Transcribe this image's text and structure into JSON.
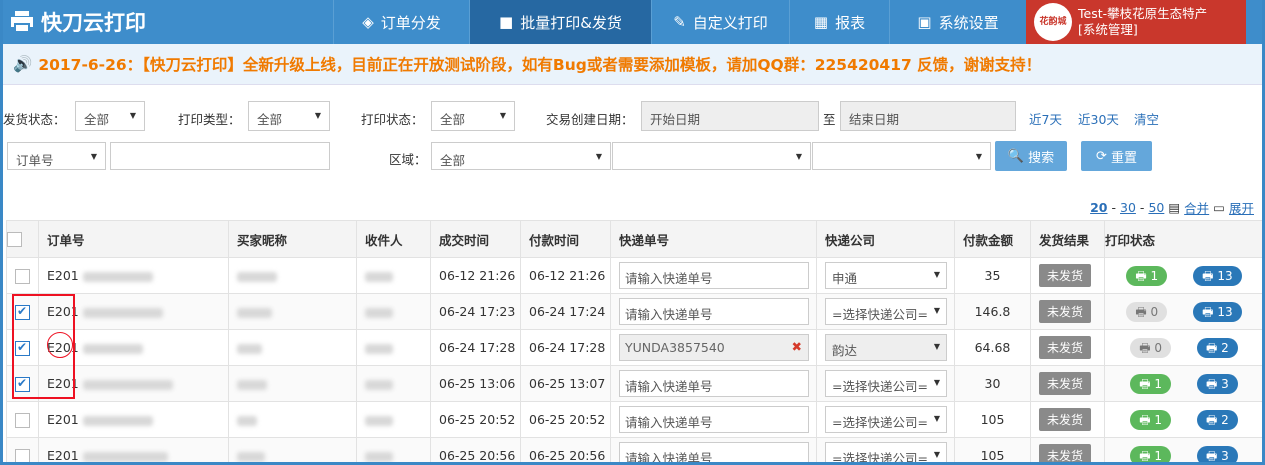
{
  "header": {
    "logo_text": "快刀云打印",
    "nav": [
      {
        "label": "订单分发",
        "icon": "share-icon"
      },
      {
        "label": "批量打印&发货",
        "icon": "ship-icon"
      },
      {
        "label": "自定义打印",
        "icon": "pencil-icon"
      },
      {
        "label": "报表",
        "icon": "calendar-icon"
      },
      {
        "label": "系统设置",
        "icon": "grid-icon"
      }
    ],
    "avatar_text": "花韵城",
    "user_line1": "Test-攀枝花原生态特产",
    "user_line2": "[系统管理]"
  },
  "notice": "2017-6-26：【快刀云打印】全新升级上线，目前正在开放测试阶段，如有Bug或者需要添加模板，请加QQ群：225420417 反馈，谢谢支持！",
  "filters": {
    "ship_status_label": "发货状态：",
    "ship_status_value": "全部",
    "print_type_label": "打印类型：",
    "print_type_value": "全部",
    "print_status_label": "打印状态：",
    "print_status_value": "全部",
    "date_label": "交易创建日期：",
    "date_start": "开始日期",
    "date_to": "至",
    "date_end": "结束日期",
    "last7": "近7天",
    "last30": "近30天",
    "clear": "清空",
    "order_field": "订单号",
    "region_label": "区域：",
    "region_value": "全部",
    "search": "搜索",
    "reset": "重置"
  },
  "pager": {
    "sizes": [
      "20",
      "30",
      "50"
    ],
    "sep": "-",
    "merge": "合并",
    "expand": "展开"
  },
  "table": {
    "headers": [
      "订单号",
      "买家昵称",
      "收件人",
      "成交时间",
      "付款时间",
      "快递单号",
      "快递公司",
      "付款金额",
      "发货结果",
      "打印状态"
    ],
    "rows": [
      {
        "checked": false,
        "order": "E201",
        "deal": "06-12 21:26",
        "pay": "06-12 21:26",
        "track": "请输入快递单号",
        "track_filled": false,
        "courier": "申通",
        "amount": "35",
        "result": "未发货",
        "p1": "1",
        "p1_on": true,
        "p2": "13"
      },
      {
        "checked": true,
        "order": "E201",
        "deal": "06-24 17:23",
        "pay": "06-24 17:24",
        "track": "请输入快递单号",
        "track_filled": false,
        "courier": "=选择快递公司=",
        "amount": "146.8",
        "result": "未发货",
        "p1": "0",
        "p1_on": false,
        "p2": "13"
      },
      {
        "checked": true,
        "order": "E201",
        "deal": "06-24 17:28",
        "pay": "06-24 17:28",
        "track": "YUNDA3857540",
        "track_filled": true,
        "courier": "韵达",
        "amount": "64.68",
        "result": "未发货",
        "p1": "0",
        "p1_on": false,
        "p2": "2"
      },
      {
        "checked": true,
        "order": "E201",
        "deal": "06-25 13:06",
        "pay": "06-25 13:07",
        "track": "请输入快递单号",
        "track_filled": false,
        "courier": "=选择快递公司=",
        "amount": "30",
        "result": "未发货",
        "p1": "1",
        "p1_on": true,
        "p2": "3"
      },
      {
        "checked": false,
        "order": "E201",
        "deal": "06-25 20:52",
        "pay": "06-25 20:52",
        "track": "请输入快递单号",
        "track_filled": false,
        "courier": "=选择快递公司=",
        "amount": "105",
        "result": "未发货",
        "p1": "1",
        "p1_on": true,
        "p2": "2"
      },
      {
        "checked": false,
        "order": "E201",
        "deal": "06-25 20:56",
        "pay": "06-25 20:56",
        "track": "请输入快递单号",
        "track_filled": false,
        "courier": "=选择快递公司=",
        "amount": "105",
        "result": "未发货",
        "p1": "1",
        "p1_on": true,
        "p2": "3"
      }
    ]
  }
}
